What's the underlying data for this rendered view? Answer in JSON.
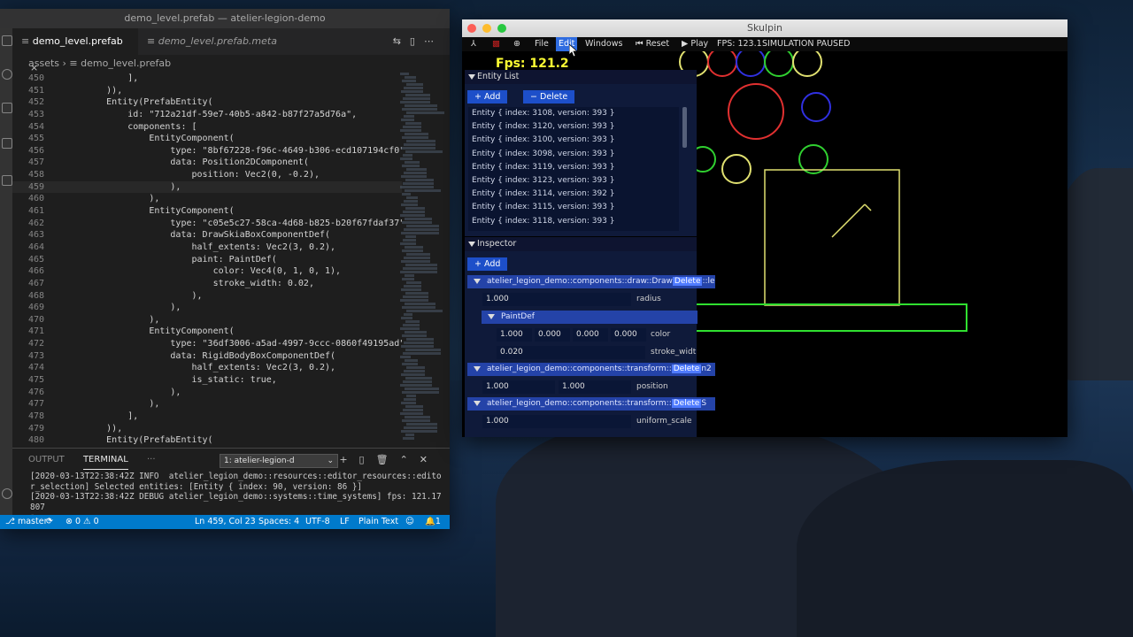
{
  "vscode": {
    "title": "demo_level.prefab — atelier-legion-demo",
    "tabs": [
      {
        "label": "demo_level.prefab",
        "active": true
      },
      {
        "label": "demo_level.prefab.meta",
        "active": false
      }
    ],
    "breadcrumb": {
      "folder": "assets",
      "file": "demo_level.prefab"
    },
    "code_lines": [
      {
        "n": "450",
        "text": "            ],"
      },
      {
        "n": "451",
        "text": "        )),"
      },
      {
        "n": "452",
        "text": "        Entity(PrefabEntity("
      },
      {
        "n": "453",
        "text": "            id: \"712a21df-59e7-40b5-a842-b87f27a5d76a\","
      },
      {
        "n": "454",
        "text": "            components: ["
      },
      {
        "n": "455",
        "text": "                EntityComponent("
      },
      {
        "n": "456",
        "text": "                    type: \"8bf67228-f96c-4649-b306-ecd107194cf0\","
      },
      {
        "n": "457",
        "text": "                    data: Position2DComponent("
      },
      {
        "n": "458",
        "text": "                        position: Vec2(0, -0.2),"
      },
      {
        "n": "459",
        "text": "                    ),"
      },
      {
        "n": "460",
        "text": "                ),"
      },
      {
        "n": "461",
        "text": "                EntityComponent("
      },
      {
        "n": "462",
        "text": "                    type: \"c05e5c27-58ca-4d68-b825-b20f67fdaf37\","
      },
      {
        "n": "463",
        "text": "                    data: DrawSkiaBoxComponentDef("
      },
      {
        "n": "464",
        "text": "                        half_extents: Vec2(3, 0.2),"
      },
      {
        "n": "465",
        "text": "                        paint: PaintDef("
      },
      {
        "n": "466",
        "text": "                            color: Vec4(0, 1, 0, 1),"
      },
      {
        "n": "467",
        "text": "                            stroke_width: 0.02,"
      },
      {
        "n": "468",
        "text": "                        ),"
      },
      {
        "n": "469",
        "text": "                    ),"
      },
      {
        "n": "470",
        "text": "                ),"
      },
      {
        "n": "471",
        "text": "                EntityComponent("
      },
      {
        "n": "472",
        "text": "                    type: \"36df3006-a5ad-4997-9ccc-0860f49195ad\","
      },
      {
        "n": "473",
        "text": "                    data: RigidBodyBoxComponentDef("
      },
      {
        "n": "474",
        "text": "                        half_extents: Vec2(3, 0.2),"
      },
      {
        "n": "475",
        "text": "                        is_static: true,"
      },
      {
        "n": "476",
        "text": "                    ),"
      },
      {
        "n": "477",
        "text": "                ),"
      },
      {
        "n": "478",
        "text": "            ],"
      },
      {
        "n": "479",
        "text": "        )),"
      },
      {
        "n": "480",
        "text": "        Entity(PrefabEntity("
      }
    ],
    "panel": {
      "tabs": [
        "OUTPUT",
        "TERMINAL"
      ],
      "more": "···",
      "terminal_select": "1: atelier-legion-d",
      "terminal_lines": [
        "[2020-03-13T22:38:42Z INFO  atelier_legion_demo::resources::editor_resources::edito",
        "r_selection] Selected entities: [Entity { index: 90, version: 86 }]",
        "[2020-03-13T22:38:42Z DEBUG atelier_legion_demo::systems::time_systems] fps: 121.17",
        "807",
        "▯"
      ]
    },
    "status": {
      "branch": "master*",
      "problems": "⊗ 0 ⚠ 0",
      "position": "Ln 459, Col 23",
      "spaces": "Spaces: 4",
      "encoding": "UTF-8",
      "eol": "LF",
      "language": "Plain Text",
      "notifications": "1"
    }
  },
  "skulpin": {
    "title": "Skulpin",
    "menu": [
      "File",
      "Edit",
      "Windows"
    ],
    "reset_label": "Reset",
    "play_label": "Play",
    "fps_text": "FPS: 123.1",
    "sim_status": "SIMULATION PAUSED",
    "fps_overlay": "Fps: 121.2",
    "entity_list": {
      "header": "Entity List",
      "add_label": "Add",
      "delete_label": "Delete",
      "items": [
        "Entity { index: 3108, version: 393 }",
        "Entity { index: 3120, version: 393 }",
        "Entity { index: 3100, version: 393 }",
        "Entity { index: 3098, version: 393 }",
        "Entity { index: 3119, version: 393 }",
        "Entity { index: 3123, version: 393 }",
        "Entity { index: 3114, version: 392 }",
        "Entity { index: 3115, version: 393 }",
        "Entity { index: 3118, version: 393 }"
      ]
    },
    "inspector": {
      "header": "Inspector",
      "add_label": "Add",
      "draw_component": "atelier_legion_demo::components::draw::Draw",
      "draw_suffix": "::le",
      "delete_label": "Delete",
      "radius_value": "1.000",
      "radius_label": "radius",
      "paintdef_label": "PaintDef",
      "color_values": [
        "1.000",
        "0.000",
        "0.000",
        "0.000"
      ],
      "color_label": "color",
      "stroke_value": "0.020",
      "stroke_label": "stroke_widt",
      "transform1_component": "atelier_legion_demo::components::transform::",
      "transform1_suffix": "n2",
      "position_values": [
        "1.000",
        "1.000"
      ],
      "position_label": "position",
      "transform2_component": "atelier_legion_demo::components::transform::",
      "transform2_suffix": "S",
      "scale_value": "1.000",
      "scale_label": "uniform_scale"
    }
  }
}
